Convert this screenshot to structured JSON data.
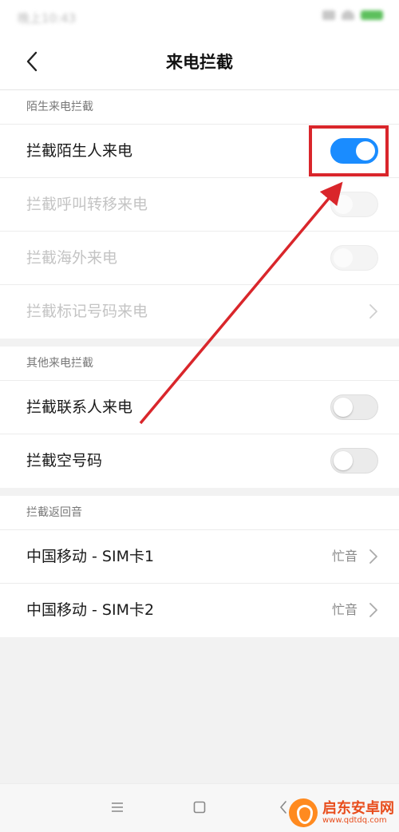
{
  "status_bar": {
    "time": "晚上10:43"
  },
  "header": {
    "title": "来电拦截"
  },
  "sections": {
    "stranger": {
      "title": "陌生来电拦截",
      "items": [
        {
          "label": "拦截陌生人来电",
          "control": "toggle",
          "checked": true,
          "enabled": true
        },
        {
          "label": "拦截呼叫转移来电",
          "control": "toggle",
          "checked": false,
          "enabled": false
        },
        {
          "label": "拦截海外来电",
          "control": "toggle",
          "checked": false,
          "enabled": false
        },
        {
          "label": "拦截标记号码来电",
          "control": "chevron",
          "enabled": false
        }
      ]
    },
    "other": {
      "title": "其他来电拦截",
      "items": [
        {
          "label": "拦截联系人来电",
          "control": "toggle",
          "checked": false,
          "enabled": true
        },
        {
          "label": "拦截空号码",
          "control": "toggle",
          "checked": false,
          "enabled": true
        }
      ]
    },
    "return_tone": {
      "title": "拦截返回音",
      "items": [
        {
          "label": "中国移动 - SIM卡1",
          "value": "忙音"
        },
        {
          "label": "中国移动 - SIM卡2",
          "value": "忙音"
        }
      ]
    }
  },
  "watermark": {
    "title": "启东安卓网",
    "url": "www.qdtdq.com"
  },
  "colors": {
    "toggle_on": "#1a8cff",
    "annotation_red": "#d9262b"
  }
}
